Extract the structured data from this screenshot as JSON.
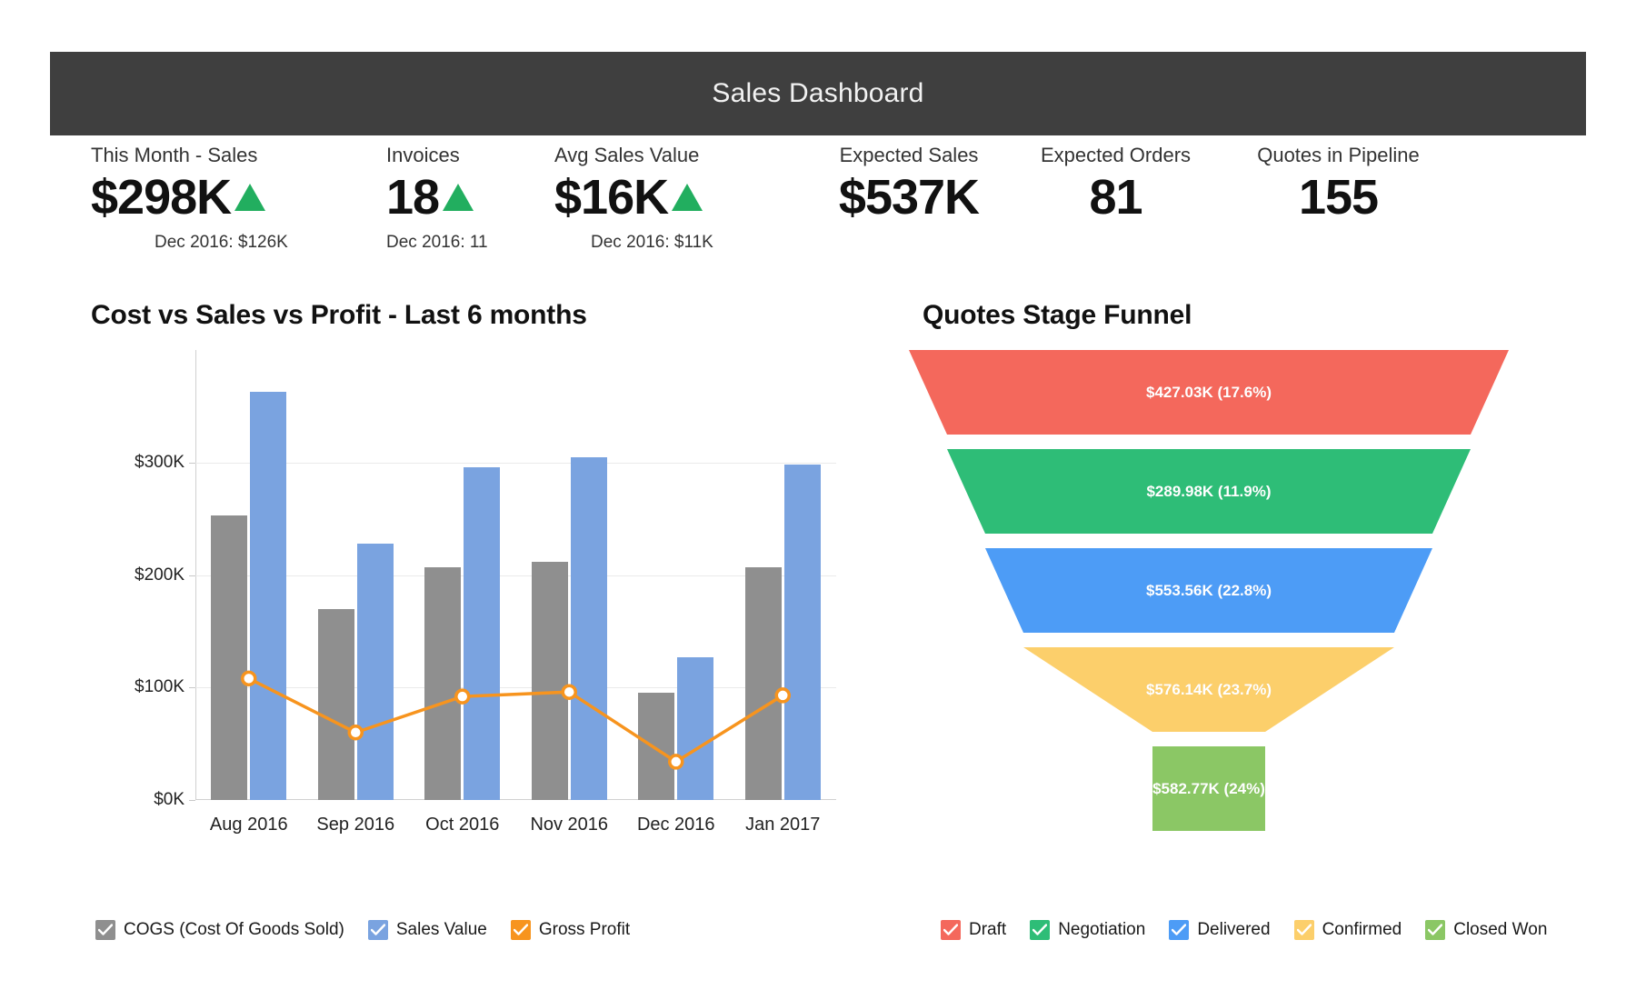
{
  "header": {
    "title": "Sales Dashboard"
  },
  "kpis": [
    {
      "label": "This Month - Sales",
      "value": "$298K",
      "trend": "up",
      "sub": "Dec 2016: $126K"
    },
    {
      "label": "Invoices",
      "value": "18",
      "trend": "up",
      "sub": "Dec 2016: 11"
    },
    {
      "label": "Avg Sales Value",
      "value": "$16K",
      "trend": "up",
      "sub": "Dec 2016: $11K"
    },
    {
      "label": "Expected Sales",
      "value": "$537K",
      "trend": "none",
      "sub": ""
    },
    {
      "label": "Expected Orders",
      "value": "81",
      "trend": "none",
      "sub": ""
    },
    {
      "label": "Quotes in Pipeline",
      "value": "155",
      "trend": "none",
      "sub": ""
    }
  ],
  "colors": {
    "trend_up": "#22ae5f",
    "cogs": "#8f8f8f",
    "sales": "#7aa3e0",
    "profit": "#f7941e",
    "header_bg": "#3f3f3f",
    "draft": "#f4685c",
    "negotiation": "#2ebd77",
    "delivered": "#4d9cf6",
    "confirmed": "#fccf6b",
    "closed_won": "#8bc765"
  },
  "bar_panel": {
    "title": "Cost vs Sales vs Profit - Last 6 months",
    "legend": [
      {
        "label": "COGS (Cost Of Goods Sold)",
        "color": "#8f8f8f",
        "icon": "checkbox-checked-icon"
      },
      {
        "label": "Sales Value",
        "color": "#7aa3e0",
        "icon": "checkbox-checked-icon"
      },
      {
        "label": "Gross Profit",
        "color": "#f7941e",
        "icon": "checkbox-checked-icon"
      }
    ]
  },
  "funnel_panel": {
    "title": "Quotes Stage Funnel",
    "legend": [
      {
        "label": "Draft",
        "color": "#f4685c",
        "icon": "checkbox-checked-icon"
      },
      {
        "label": "Negotiation",
        "color": "#2ebd77",
        "icon": "checkbox-checked-icon"
      },
      {
        "label": "Delivered",
        "color": "#4d9cf6",
        "icon": "checkbox-checked-icon"
      },
      {
        "label": "Confirmed",
        "color": "#fccf6b",
        "icon": "checkbox-checked-icon"
      },
      {
        "label": "Closed Won",
        "color": "#8bc765",
        "icon": "checkbox-checked-icon"
      }
    ]
  },
  "chart_data": [
    {
      "type": "bar",
      "title": "Cost vs Sales vs Profit - Last 6 months",
      "xlabel": "",
      "ylabel": "",
      "categories": [
        "Aug 2016",
        "Sep 2016",
        "Oct 2016",
        "Nov 2016",
        "Dec 2016",
        "Jan 2017"
      ],
      "yticks": [
        "$0K",
        "$100K",
        "$200K",
        "$300K"
      ],
      "ytick_values": [
        0,
        100000,
        200000,
        300000
      ],
      "ylim": [
        0,
        400000
      ],
      "grid": true,
      "legend_position": "bottom-left",
      "series": [
        {
          "name": "COGS (Cost Of Goods Sold)",
          "type": "bar",
          "color": "#8f8f8f",
          "values": [
            253000,
            170000,
            207000,
            212000,
            95000,
            207000
          ]
        },
        {
          "name": "Sales Value",
          "type": "bar",
          "color": "#7aa3e0",
          "values": [
            363000,
            228000,
            296000,
            305000,
            127000,
            298000
          ]
        },
        {
          "name": "Gross Profit",
          "type": "line",
          "color": "#f7941e",
          "values": [
            108000,
            60000,
            92000,
            96000,
            34000,
            93000
          ]
        }
      ]
    },
    {
      "type": "funnel",
      "title": "Quotes Stage Funnel",
      "legend_position": "bottom",
      "stages": [
        {
          "name": "Draft",
          "label": "$427.03K (17.6%)",
          "value": 427030,
          "percent": 17.6,
          "color": "#f4685c"
        },
        {
          "name": "Negotiation",
          "label": "$289.98K (11.9%)",
          "value": 289980,
          "percent": 11.9,
          "color": "#2ebd77"
        },
        {
          "name": "Delivered",
          "label": "$553.56K (22.8%)",
          "value": 553560,
          "percent": 22.8,
          "color": "#4d9cf6"
        },
        {
          "name": "Confirmed",
          "label": "$576.14K (23.7%)",
          "value": 576140,
          "percent": 23.7,
          "color": "#fccf6b"
        },
        {
          "name": "Closed Won",
          "label": "$582.77K (24%)",
          "value": 582770,
          "percent": 24.0,
          "color": "#8bc765"
        }
      ]
    }
  ]
}
